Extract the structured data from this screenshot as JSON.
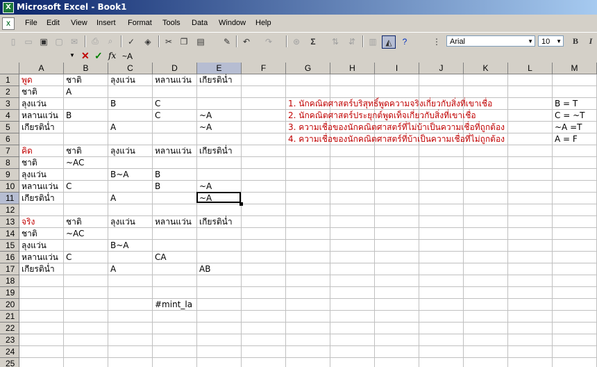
{
  "window": {
    "title": "Microsoft Excel - Book1"
  },
  "menu": [
    "File",
    "Edit",
    "View",
    "Insert",
    "Format",
    "Tools",
    "Data",
    "Window",
    "Help"
  ],
  "toolbar": {
    "font": "Arial",
    "size": "10",
    "bold": "B",
    "italic": "I",
    "sum": "Σ"
  },
  "formula": {
    "namebox": "",
    "value": "~A",
    "fx": "fx"
  },
  "columns": [
    "A",
    "B",
    "C",
    "D",
    "E",
    "F",
    "G",
    "H",
    "I",
    "J",
    "K",
    "L",
    "M"
  ],
  "rows": [
    "1",
    "2",
    "3",
    "4",
    "5",
    "6",
    "7",
    "8",
    "9",
    "10",
    "11",
    "12",
    "13",
    "14",
    "15",
    "16",
    "17",
    "18",
    "19",
    "20",
    "21",
    "22",
    "23",
    "24",
    "25"
  ],
  "active_cell": {
    "col": "E",
    "row": "11"
  },
  "cells": [
    {
      "r": 1,
      "c": "A",
      "v": "พูด",
      "red": true
    },
    {
      "r": 1,
      "c": "B",
      "v": "ชาติ"
    },
    {
      "r": 1,
      "c": "C",
      "v": "ลุงแว่น"
    },
    {
      "r": 1,
      "c": "D",
      "v": "หลานแว่น"
    },
    {
      "r": 1,
      "c": "E",
      "v": "เกียรติน่ำ"
    },
    {
      "r": 2,
      "c": "A",
      "v": "ชาติ"
    },
    {
      "r": 2,
      "c": "B",
      "v": "A"
    },
    {
      "r": 3,
      "c": "A",
      "v": "ลุงแว่น"
    },
    {
      "r": 3,
      "c": "C",
      "v": "B"
    },
    {
      "r": 3,
      "c": "D",
      "v": "C"
    },
    {
      "r": 4,
      "c": "A",
      "v": "หลานแว่น"
    },
    {
      "r": 4,
      "c": "B",
      "v": "B"
    },
    {
      "r": 4,
      "c": "D",
      "v": "C"
    },
    {
      "r": 4,
      "c": "E",
      "v": "~A"
    },
    {
      "r": 5,
      "c": "A",
      "v": "เกียรติน่ำ"
    },
    {
      "r": 5,
      "c": "C",
      "v": "A"
    },
    {
      "r": 5,
      "c": "E",
      "v": "~A"
    },
    {
      "r": 7,
      "c": "A",
      "v": "คิด",
      "red": true
    },
    {
      "r": 7,
      "c": "B",
      "v": "ชาติ"
    },
    {
      "r": 7,
      "c": "C",
      "v": "ลุงแว่น"
    },
    {
      "r": 7,
      "c": "D",
      "v": "หลานแว่น"
    },
    {
      "r": 7,
      "c": "E",
      "v": "เกียรติน่ำ"
    },
    {
      "r": 8,
      "c": "A",
      "v": "ชาติ"
    },
    {
      "r": 8,
      "c": "B",
      "v": "~AC"
    },
    {
      "r": 9,
      "c": "A",
      "v": "ลุงแว่น"
    },
    {
      "r": 9,
      "c": "C",
      "v": "B~A"
    },
    {
      "r": 9,
      "c": "D",
      "v": "B"
    },
    {
      "r": 10,
      "c": "A",
      "v": "หลานแว่น"
    },
    {
      "r": 10,
      "c": "B",
      "v": "C"
    },
    {
      "r": 10,
      "c": "D",
      "v": "B"
    },
    {
      "r": 10,
      "c": "E",
      "v": "~A"
    },
    {
      "r": 11,
      "c": "A",
      "v": "เกียรติน่ำ"
    },
    {
      "r": 11,
      "c": "C",
      "v": "A"
    },
    {
      "r": 11,
      "c": "E",
      "v": "~A"
    },
    {
      "r": 13,
      "c": "A",
      "v": "จริง",
      "red": true
    },
    {
      "r": 13,
      "c": "B",
      "v": "ชาติ"
    },
    {
      "r": 13,
      "c": "C",
      "v": "ลุงแว่น"
    },
    {
      "r": 13,
      "c": "D",
      "v": "หลานแว่น"
    },
    {
      "r": 13,
      "c": "E",
      "v": "เกียรติน่ำ"
    },
    {
      "r": 14,
      "c": "A",
      "v": "ชาติ"
    },
    {
      "r": 14,
      "c": "B",
      "v": "~AC"
    },
    {
      "r": 15,
      "c": "A",
      "v": "ลุงแว่น"
    },
    {
      "r": 15,
      "c": "C",
      "v": "B~A"
    },
    {
      "r": 16,
      "c": "A",
      "v": "หลานแว่น"
    },
    {
      "r": 16,
      "c": "B",
      "v": "C"
    },
    {
      "r": 16,
      "c": "D",
      "v": "CA"
    },
    {
      "r": 17,
      "c": "A",
      "v": "เกียรติน่ำ"
    },
    {
      "r": 17,
      "c": "C",
      "v": "A"
    },
    {
      "r": 17,
      "c": "E",
      "v": "AB"
    },
    {
      "r": 20,
      "c": "D",
      "v": "#mint_la"
    },
    {
      "r": 3,
      "c": "G",
      "v": "1. นักคณิตศาสตร์บริสุทธิ์พูดความจริงเกี่ยวกับสิ่งที่เขาเชื่อ",
      "red": true
    },
    {
      "r": 4,
      "c": "G",
      "v": "2. นักคณิตศาสตร์ประยุกต์พูดเท็จเกี่ยวกับสิ่งที่เขาเชื่อ",
      "red": true
    },
    {
      "r": 5,
      "c": "G",
      "v": "3. ความเชื่อของนักคณิตศาสตร์ที่ไม่บ้าเป็นความเชื่อที่ถูกต้อง",
      "red": true
    },
    {
      "r": 6,
      "c": "G",
      "v": "4. ความเชื่อของนักคณิตศาสตร์ที่บ้าเป็นความเชื่อที่ไม่ถูกต้อง",
      "red": true
    },
    {
      "r": 3,
      "c": "M",
      "v": "B = T"
    },
    {
      "r": 4,
      "c": "M",
      "v": "C = ~T"
    },
    {
      "r": 5,
      "c": "M",
      "v": "~A =T"
    },
    {
      "r": 6,
      "c": "M",
      "v": "A = F"
    }
  ]
}
